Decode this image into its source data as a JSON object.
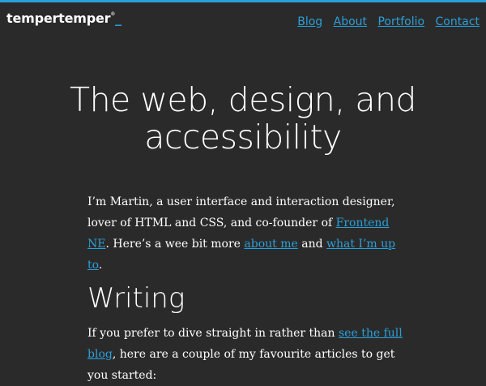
{
  "header": {
    "logo_text": "tempertemper",
    "logo_mark": "®",
    "logo_cursor": "_",
    "nav": {
      "blog": "Blog",
      "about": "About",
      "portfolio": "Portfolio",
      "contact": "Contact"
    }
  },
  "hero": {
    "title_line1": "The web, design, and",
    "title_line2": "accessibility"
  },
  "intro": {
    "text1": "I’m Martin, a user interface and interaction designer, lover of HTML and CSS, and co-founder of ",
    "link_frontend": "Frontend NE",
    "text2": ". Here’s a wee bit more ",
    "link_about": "about me",
    "text3": " and ",
    "link_upto": "what I’m up to",
    "text4": "."
  },
  "writing": {
    "title": "Writing",
    "text1": "If you prefer to dive straight in rather than ",
    "link_blog": "see the full blog",
    "text2": ", here are a couple of my favourite articles to get you started:"
  },
  "colors": {
    "background": "#2a2a2a",
    "accent": "#2a9fd8",
    "text": "#ffffff"
  }
}
